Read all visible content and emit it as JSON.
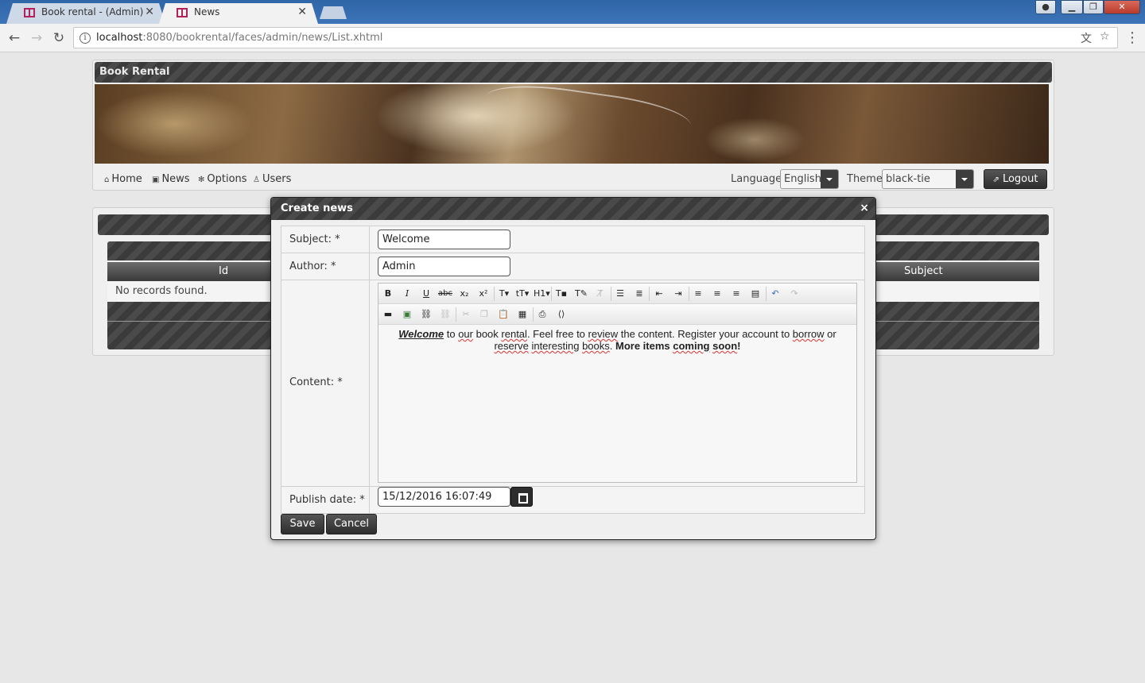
{
  "browser": {
    "tabs": [
      {
        "title": "Book rental - (Admin)",
        "active": false
      },
      {
        "title": "News",
        "active": true
      }
    ],
    "address_host": "localhost",
    "address_rest": ":8080/bookrental/faces/admin/news/List.xhtml",
    "icons": {
      "back": "back-arrow-icon",
      "forward": "forward-arrow-icon",
      "reload": "reload-icon",
      "info": "info-icon",
      "translate": "translate-icon",
      "bookmark": "star-icon",
      "menu": "kebab-menu-icon"
    }
  },
  "layout": {
    "title": "Book Rental"
  },
  "menu": {
    "items": [
      {
        "label": "Home",
        "icon": "home-icon"
      },
      {
        "label": "News",
        "icon": "news-icon"
      },
      {
        "label": "Options",
        "icon": "gear-icon"
      },
      {
        "label": "Users",
        "icon": "user-icon"
      }
    ],
    "language_label": "Language",
    "language_value": "English",
    "theme_label": "Theme",
    "theme_value": "black-tie",
    "logout_label": "Logout"
  },
  "table": {
    "columns": [
      "Id",
      "Subject"
    ],
    "empty_message": "No records found."
  },
  "dialog": {
    "title": "Create news",
    "close": "×",
    "fields": {
      "subject_label": "Subject: *",
      "subject_value": "Welcome",
      "author_label": "Author: *",
      "author_value": "Admin",
      "content_label": "Content: *",
      "publish_label": "Publish date: *",
      "publish_value": "15/12/2016 16:07:49"
    },
    "content_html_parts": {
      "w1": "Welcome",
      "t1": " to ",
      "s1": "our",
      "t2": " book ",
      "s2": "rental",
      "t3": ". Feel free to ",
      "s3": "review",
      "t4": " the content. Register your account to ",
      "s4": "borrow",
      "t5": " or ",
      "s5": "reserve",
      "t6": " ",
      "s6": "interesting",
      "t7": " ",
      "s7": "books",
      "t8": ". ",
      "b1": "More items ",
      "b2": "coming",
      "b3": " ",
      "b4": "soon",
      "b5": "!"
    },
    "save_label": "Save",
    "cancel_label": "Cancel"
  },
  "colors": {
    "header_dark": "#3b3b3b",
    "chrome_blue": "#2f66a8",
    "spellcheck": "#dd3333"
  }
}
